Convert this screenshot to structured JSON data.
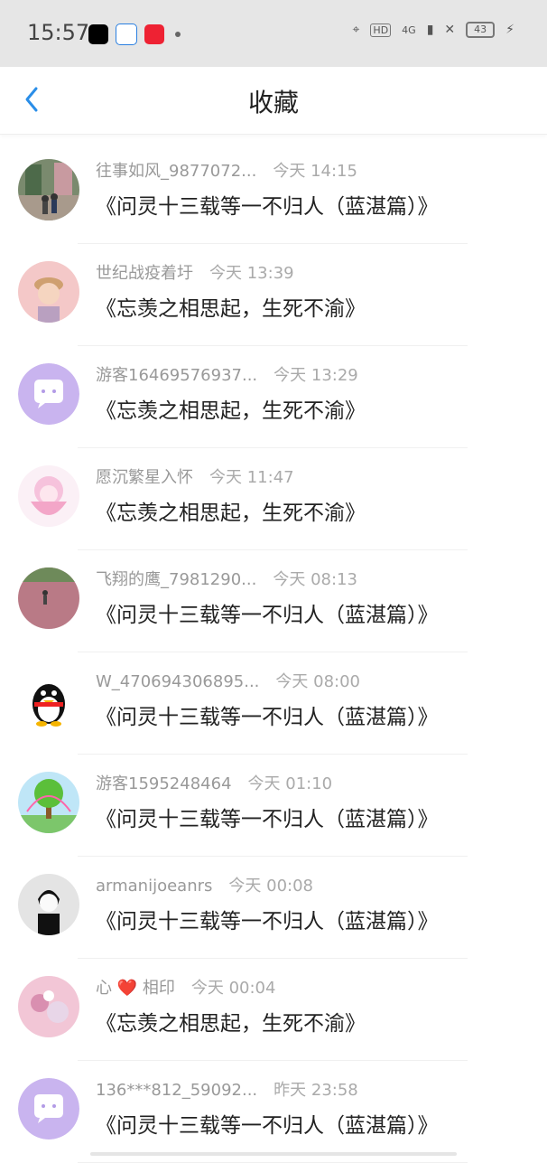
{
  "status": {
    "time": "15:57",
    "battery": "43",
    "network": "4G"
  },
  "header": {
    "title": "收藏"
  },
  "items": [
    {
      "username": "往事如风_9877072...",
      "time": "今天 14:15",
      "title": "《问灵十三载等一不归人（蓝湛篇）》",
      "avatar": "photo-street"
    },
    {
      "username": "世纪战疫着圩",
      "time": "今天 13:39",
      "title": "《忘羡之相思起，生死不渝》",
      "avatar": "photo-boy"
    },
    {
      "username": "游客16469576937...",
      "time": "今天 13:29",
      "title": "《忘羡之相思起，生死不渝》",
      "avatar": "default-chat"
    },
    {
      "username": "愿沉繁星入怀",
      "time": "今天 11:47",
      "title": "《忘羡之相思起，生死不渝》",
      "avatar": "anime-pink"
    },
    {
      "username": "飞翔的鹰_7981290...",
      "time": "今天 08:13",
      "title": "《问灵十三载等一不归人（蓝湛篇）》",
      "avatar": "photo-field"
    },
    {
      "username": "W_470694306895...",
      "time": "今天 08:00",
      "title": "《问灵十三载等一不归人（蓝湛篇）》",
      "avatar": "qq-penguin"
    },
    {
      "username": "游客1595248464",
      "time": "今天 01:10",
      "title": "《问灵十三载等一不归人（蓝湛篇）》",
      "avatar": "tree-cartoon"
    },
    {
      "username": "armanijoeanrs",
      "time": "今天 00:08",
      "title": "《问灵十三载等一不归人（蓝湛篇）》",
      "avatar": "anime-dark"
    },
    {
      "username": "心 ❤️ 相印",
      "time": "今天 00:04",
      "title": "《忘羡之相思起，生死不渝》",
      "avatar": "photo-pink"
    },
    {
      "username": "136***812_59092...",
      "time": "昨天 23:58",
      "title": "《问灵十三载等一不归人（蓝湛篇）》",
      "avatar": "default-chat"
    }
  ]
}
